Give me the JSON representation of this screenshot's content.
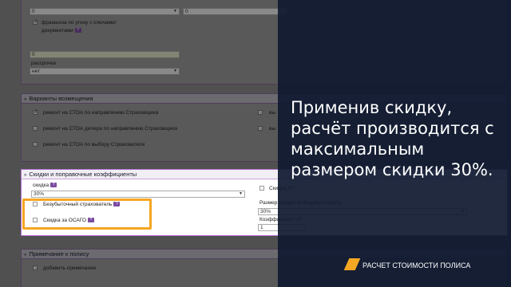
{
  "top": {
    "select_left_value": "0",
    "select_right_value": "0",
    "franchise_label_line1": "франшиза по угону с ключами/",
    "franchise_label_line2": "документами",
    "input_value": "0",
    "installment_label": "рассрочка",
    "installment_value": "нет"
  },
  "compensation": {
    "title": "Варианты возмещения",
    "options": [
      {
        "label": "ремонт на СТОА по направлению Страховщика",
        "checked": true
      },
      {
        "label": "ремонт на СТОА дилера по направлению Страховщика",
        "checked": false
      },
      {
        "label": "ремонт на СТОА по выбору Страхователя",
        "checked": false
      }
    ],
    "right_options": [
      "вы",
      "вы"
    ]
  },
  "discounts": {
    "title": "Скидки и поправочные коэффициенты",
    "discount_label": "скидка",
    "discount_value": "30%",
    "lossless_label": "Безубыточный страхователь",
    "osago_label": "Скидка за ОСАГО",
    "right_checkbox_label": "Скидка УП",
    "max_size_label": "Размер скидки за безубыточность",
    "max_size_value": "30%",
    "coef_label": "Коэффициент УП",
    "coef_value": "1"
  },
  "note": {
    "title": "Примечание к полису",
    "add_label": "добавить примечание"
  },
  "overlay": {
    "message": "Применив скидку, расчёт производится с максимальным размером скидки 30%.",
    "footer": "РАСЧЕТ СТОИМОСТИ ПОЛИСА"
  },
  "colors": {
    "overlay_bg": "#101a30",
    "accent": "#f5a623",
    "panel_border": "#b56fd0"
  }
}
